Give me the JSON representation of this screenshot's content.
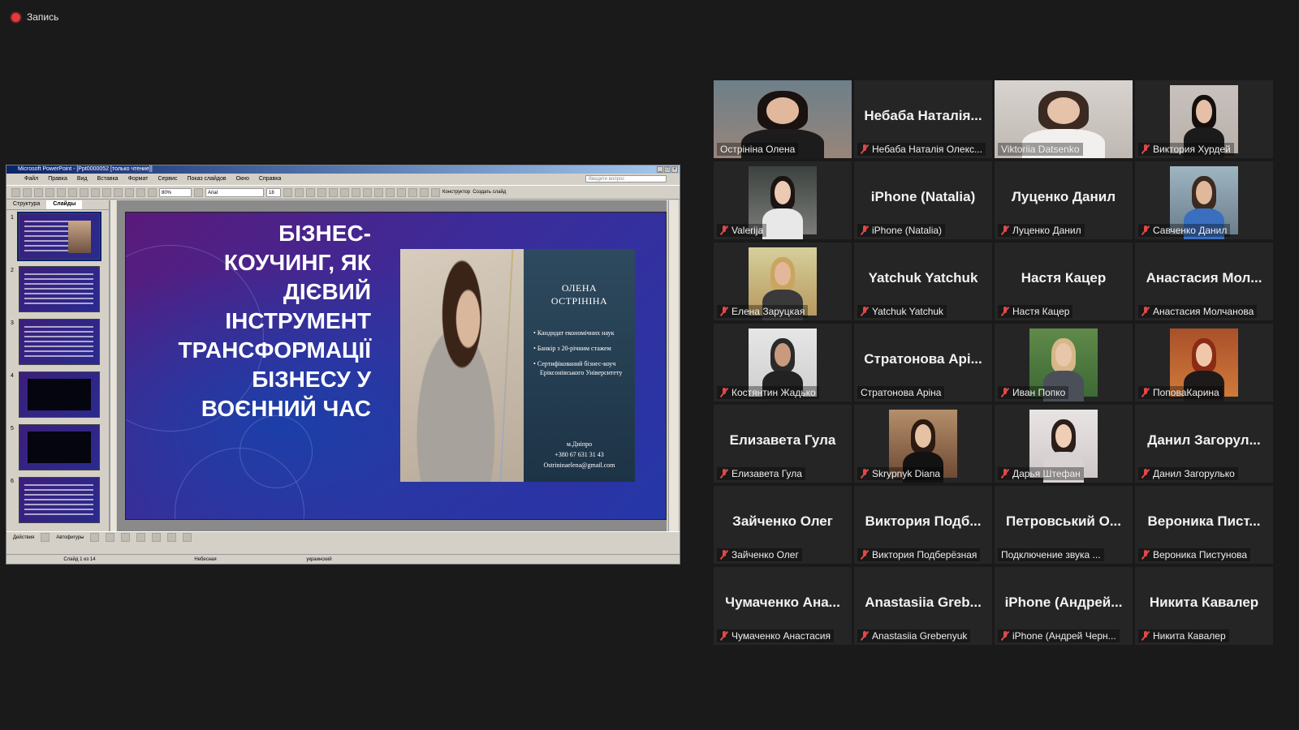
{
  "recording": {
    "label": "Запись"
  },
  "ppt": {
    "window_title": "Microsoft PowerPoint - [Ppt0000052 [только чтение]]",
    "menu": [
      "Файл",
      "Правка",
      "Вид",
      "Вставка",
      "Формат",
      "Сервис",
      "Показ слайдов",
      "Окно",
      "Справка"
    ],
    "ask_placeholder": "Введите вопрос",
    "toolbar": {
      "zoom": "80%",
      "font": "Arial",
      "size": "18",
      "designer": "Конструктор",
      "new_slide": "Создать слайд"
    },
    "pane_tabs": [
      "Структура",
      "Слайды"
    ],
    "thumbs": [
      "1",
      "2",
      "3",
      "4",
      "5",
      "6"
    ],
    "draw_toolbar": {
      "actions": "Действия",
      "autoshapes": "Автофигуры"
    },
    "status": {
      "slide": "Слайд 1 из 14",
      "design": "Небесная",
      "language": "украинский"
    }
  },
  "slide": {
    "title_lines": [
      "БІЗНЕС-",
      "КОУЧИНГ, ЯК",
      "ДІЄВИЙ",
      "ІНСТРУМЕНТ",
      "ТРАНСФОРМАЦІЇ",
      "БІЗНЕСУ У",
      "ВОЄННИЙ ЧАС"
    ],
    "name_lines": [
      "ОЛЕНА",
      "ОСТРІНІНА"
    ],
    "bullets": [
      "Кандидат економічних наук",
      "Банкір з 20-річним стажем",
      "Сертифікований бізнес-коуч"
    ],
    "bullet_extra": "Еріксонівського Університету",
    "contact": [
      "м.Дніпро",
      "+380 67 631 31 43",
      "Ostrininaelena@gmail.com"
    ]
  },
  "participants": [
    {
      "big": "",
      "label": "Острініна Олена",
      "muted": false,
      "video": "woman-dark",
      "active": true
    },
    {
      "big": "Небаба Наталія...",
      "label": "Небаба Наталія Олекс...",
      "muted": true,
      "video": ""
    },
    {
      "big": "",
      "label": "Viktoriia Datsenko",
      "muted": false,
      "video": "woman-light"
    },
    {
      "big": "",
      "label": "Виктория Хурдей",
      "muted": true,
      "video": "woman-dark2"
    },
    {
      "big": "",
      "label": "Valerija",
      "muted": true,
      "video": "woman-dark3"
    },
    {
      "big": "iPhone (Natalia)",
      "label": "iPhone (Natalia)",
      "muted": true,
      "video": ""
    },
    {
      "big": "Луценко Данил",
      "label": "Луценко Данил",
      "muted": true,
      "video": ""
    },
    {
      "big": "",
      "label": "Савченко Данил",
      "muted": true,
      "video": "man-blue"
    },
    {
      "big": "",
      "label": "Елена Заруцкая",
      "muted": true,
      "video": "woman-blonde"
    },
    {
      "big": "Yatchuk Yatchuk",
      "label": "Yatchuk Yatchuk",
      "muted": true,
      "video": ""
    },
    {
      "big": "Настя Кацер",
      "label": "Настя Кацер",
      "muted": true,
      "video": ""
    },
    {
      "big": "Анастасия Мол...",
      "label": "Анастасия Молчанова",
      "muted": true,
      "video": ""
    },
    {
      "big": "",
      "label": "Костянтин Жадько",
      "muted": true,
      "video": "man-dark"
    },
    {
      "big": "Стратонова Арі...",
      "label": "Стратонова Аріна",
      "muted": false,
      "video": ""
    },
    {
      "big": "",
      "label": "Иван Попко",
      "muted": true,
      "video": "boy-green"
    },
    {
      "big": "",
      "label": "ПоповаКарина",
      "muted": true,
      "video": "girl-red"
    },
    {
      "big": "Елизавета Гула",
      "label": "Елизавета Гула",
      "muted": true,
      "video": ""
    },
    {
      "big": "",
      "label": "Skrypnyk Diana",
      "muted": true,
      "video": "girl-dark"
    },
    {
      "big": "",
      "label": "Дарья Штефан",
      "muted": true,
      "video": "girl-light"
    },
    {
      "big": "Данил Загорул...",
      "label": "Данил Загорулько",
      "muted": true,
      "video": ""
    },
    {
      "big": "Зайченко Олег",
      "label": "Зайченко Олег",
      "muted": true,
      "video": ""
    },
    {
      "big": "Виктория Подб...",
      "label": "Виктория Подберёзная",
      "muted": true,
      "video": ""
    },
    {
      "big": "Петровський О...",
      "label": "Подключение звука ...",
      "muted": false,
      "video": ""
    },
    {
      "big": "Вероника Пист...",
      "label": "Вероника Пистунова",
      "muted": true,
      "video": ""
    },
    {
      "big": "Чумаченко Ана...",
      "label": "Чумаченко Анастасия",
      "muted": true,
      "video": ""
    },
    {
      "big": "Anastasiia Greb...",
      "label": "Anastasiia Grebenyuk",
      "muted": true,
      "video": ""
    },
    {
      "big": "iPhone (Андрей...",
      "label": "iPhone (Андрей Черн...",
      "muted": true,
      "video": ""
    },
    {
      "big": "Никита Кавалер",
      "label": "Никита Кавалер",
      "muted": true,
      "video": ""
    }
  ]
}
